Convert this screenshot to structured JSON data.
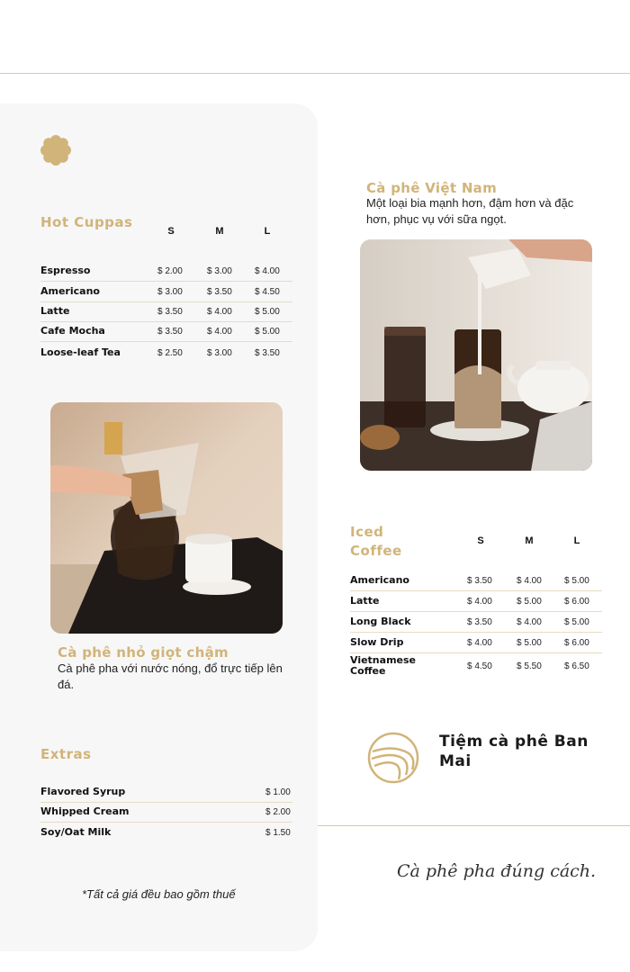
{
  "hot": {
    "title": "Hot Cuppas",
    "sizes": [
      "S",
      "M",
      "L"
    ],
    "items": [
      {
        "name": "Espresso",
        "prices": [
          "$ 2.00",
          "$ 3.00",
          "$ 4.00"
        ]
      },
      {
        "name": "Americano",
        "prices": [
          "$ 3.00",
          "$ 3.50",
          "$ 4.50"
        ]
      },
      {
        "name": "Latte",
        "prices": [
          "$ 3.50",
          "$ 4.00",
          "$ 5.00"
        ]
      },
      {
        "name": "Cafe Mocha",
        "prices": [
          "$ 3.50",
          "$ 4.00",
          "$ 5.00"
        ]
      },
      {
        "name": "Loose-leaf Tea",
        "prices": [
          "$ 2.50",
          "$ 3.00",
          "$ 3.50"
        ]
      }
    ]
  },
  "iced": {
    "title": "Iced Coffee",
    "sizes": [
      "S",
      "M",
      "L"
    ],
    "items": [
      {
        "name": "Americano",
        "prices": [
          "$ 3.50",
          "$ 4.00",
          "$ 5.00"
        ]
      },
      {
        "name": "Latte",
        "prices": [
          "$ 4.00",
          "$ 5.00",
          "$ 6.00"
        ]
      },
      {
        "name": "Long Black",
        "prices": [
          "$ 3.50",
          "$ 4.00",
          "$ 5.00"
        ]
      },
      {
        "name": "Slow Drip",
        "prices": [
          "$ 4.00",
          "$ 5.00",
          "$ 6.00"
        ]
      },
      {
        "name": "Vietnamese Coffee",
        "prices": [
          "$ 4.50",
          "$ 5.50",
          "$ 6.50"
        ]
      }
    ]
  },
  "extras": {
    "title": "Extras",
    "items": [
      {
        "name": "Flavored Syrup",
        "price": "$ 1.00"
      },
      {
        "name": "Whipped Cream",
        "price": "$ 2.00"
      },
      {
        "name": "Soy/Oat Milk",
        "price": "$ 1.50"
      }
    ]
  },
  "drip_caption": {
    "title": "Cà phê nhỏ giọt chậm",
    "text": "Cà phê pha với nước nóng, đổ trực tiếp lên đá."
  },
  "viet_caption": {
    "title": "Cà phê Việt Nam",
    "text": "Một loại bia mạnh hơn, đậm hơn và đặc hơn, phục vụ với sữa ngọt."
  },
  "brand": {
    "name": "Tiệm cà phê Ban Mai"
  },
  "tagline": "Cà phê pha đúng cách.",
  "footnote": "*Tất cả giá đều bao gồm thuế",
  "colors": {
    "accent": "#d1b47a",
    "panel": "#f7f7f7",
    "text": "#1a1a1a"
  },
  "icons": {
    "flower": "flower-icon",
    "logo": "wave-logo-icon"
  }
}
